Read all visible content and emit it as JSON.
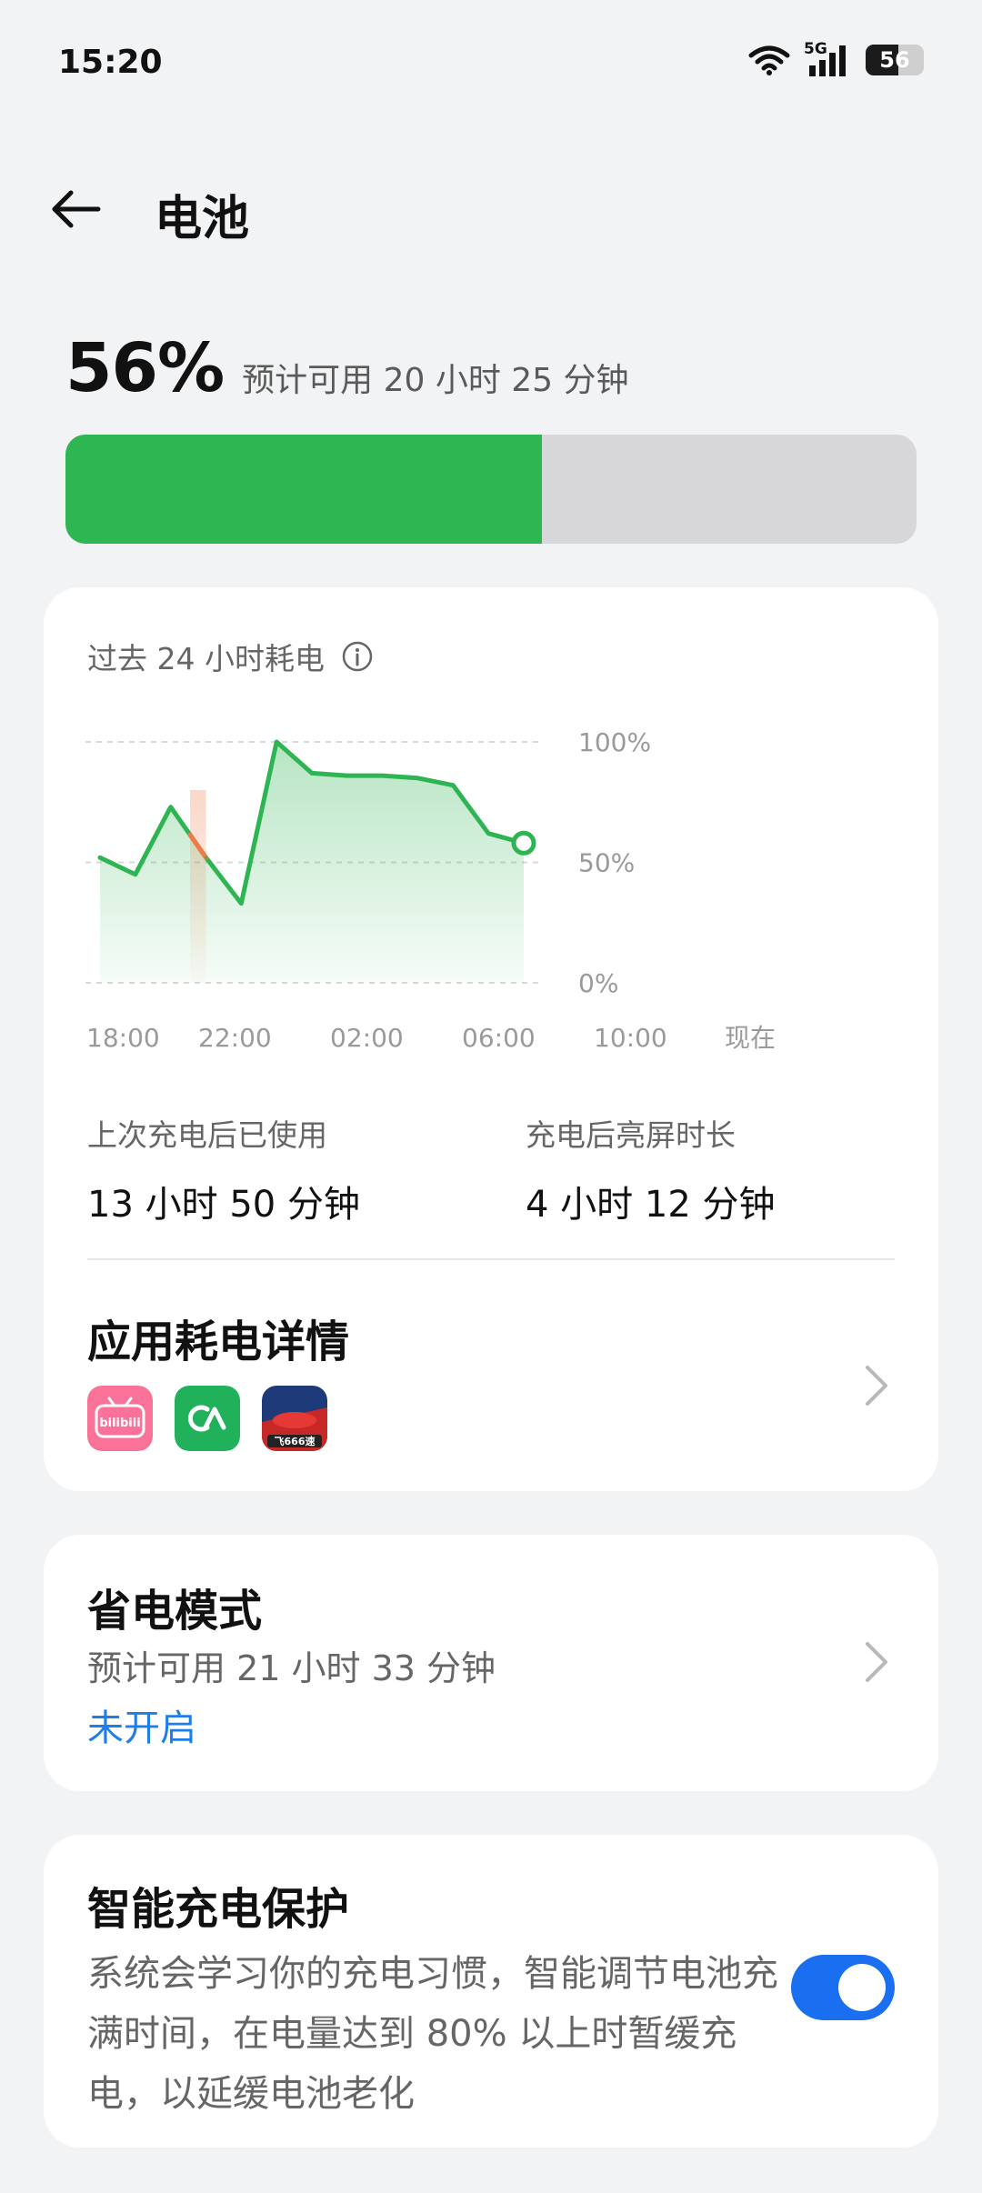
{
  "status_bar": {
    "time": "15:20",
    "network": "5G",
    "battery_level": "56"
  },
  "header": {
    "title": "电池",
    "back_icon": "arrow-left-icon"
  },
  "battery": {
    "percent_text": "56%",
    "percent_value": 56,
    "estimate": "预计可用 20 小时 25 分钟",
    "fill_color": "#2eb653",
    "track_color": "#d7d7d9"
  },
  "usage_card": {
    "title": "过去 24 小时耗电",
    "info_icon": "info-icon",
    "stats": [
      {
        "label": "上次充电后已使用",
        "value": "13 小时 50 分钟"
      },
      {
        "label": "充电后亮屏时长",
        "value": "4 小时 12 分钟"
      }
    ],
    "app_detail_title": "应用耗电详情",
    "apps": [
      {
        "name": "bilibili",
        "icon": "bilibili-app-icon",
        "color": "#fb7299",
        "text": "bilibili"
      },
      {
        "name": "app2",
        "icon": "green-app-icon",
        "color": "#21b15a"
      },
      {
        "name": "game",
        "icon": "racing-game-icon",
        "color": "#c62828",
        "text": "飞666速"
      }
    ]
  },
  "chart_data": {
    "type": "line",
    "y_tick_labels": [
      "100%",
      "50%",
      "0%"
    ],
    "x_tick_labels": [
      "18:00",
      "22:00",
      "02:00",
      "06:00",
      "10:00",
      "现在"
    ],
    "ylim": [
      0,
      100
    ],
    "grid": true,
    "line_color": "#2fb453",
    "highlight_color": "#f07a4a",
    "series": [
      {
        "x": [
          0,
          2,
          4,
          6,
          8,
          10,
          12,
          14,
          16,
          18,
          20,
          22,
          24
        ],
        "values": [
          52,
          45,
          73,
          52,
          33,
          100,
          87,
          86,
          86,
          85,
          82,
          62,
          58
        ]
      }
    ],
    "highlight_range": [
      5.1,
      6.0
    ],
    "end_marker": true
  },
  "saver_card": {
    "title": "省电模式",
    "subtitle": "预计可用 21 小时 33 分钟",
    "status": "未开启",
    "status_color": "#1e7ee8"
  },
  "protect_card": {
    "title": "智能充电保护",
    "description": "系统会学习你的充电习惯，智能调节电池充满时间，在电量达到 80% 以上时暂缓充电，以延缓电池老化",
    "toggle_on": true,
    "toggle_color": "#1a6ef0"
  }
}
